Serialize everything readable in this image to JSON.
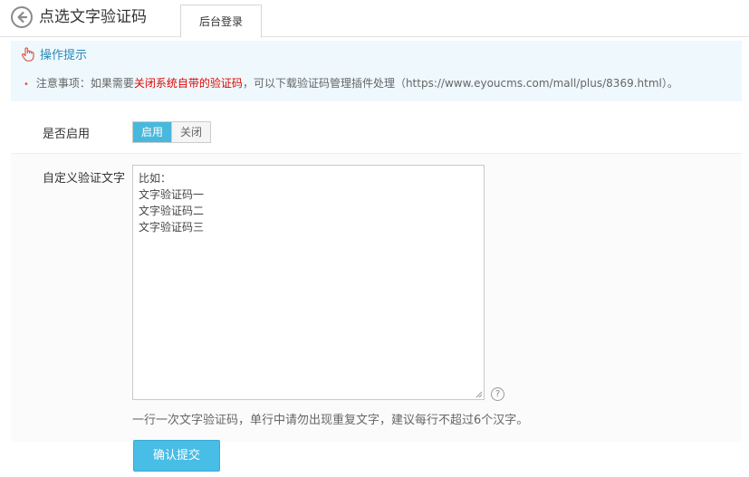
{
  "header": {
    "title": "点选文字验证码",
    "tab_label": "后台登录"
  },
  "tips": {
    "title": "操作提示",
    "line_prefix": "注意事项：如果需要",
    "line_highlight": "关闭系统自带的验证码",
    "line_suffix": "，可以下载验证码管理插件处理（https://www.eyoucms.com/mall/plus/8369.html）。"
  },
  "form": {
    "enable_label": "是否启用",
    "toggle_on": "启用",
    "toggle_off": "关闭",
    "toggle_selected": "启用",
    "custom_text_label": "自定义验证文字",
    "textarea_lines": [
      "比如：",
      "文字验证码一",
      "文字验证码二",
      "文字验证码三"
    ],
    "help_symbol": "?",
    "hint": "一行一次文字验证码，单行中请勿出现重复文字，建议每行不超过6个汉字。",
    "submit_label": "确认提交"
  },
  "colors": {
    "accent": "#48bde6",
    "highlight_red": "#e10600",
    "tips_bg": "#eef8fd"
  },
  "icons": {
    "back": "back-arrow-icon",
    "hand": "hand-pointer-icon",
    "help": "question-circle-icon"
  }
}
